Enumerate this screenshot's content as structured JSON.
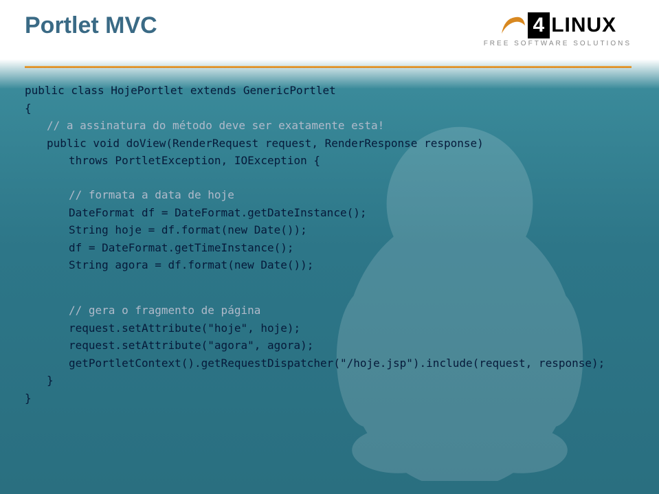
{
  "header": {
    "title": "Portlet MVC",
    "logo_brand": "LINUX",
    "logo_four": "4",
    "logo_tagline": "FREE SOFTWARE SOLUTIONS"
  },
  "code": {
    "l01": "public class HojePortlet extends GenericPortlet",
    "l02": "{",
    "l03": "// a assinatura do método deve ser exatamente esta!",
    "l04": "public void doView(RenderRequest request, RenderResponse response)",
    "l05": "throws PortletException, IOException {",
    "l06": "// formata a data de hoje",
    "l07": "DateFormat df = DateFormat.getDateInstance();",
    "l08": "String hoje = df.format(new Date());",
    "l09": "df = DateFormat.getTimeInstance();",
    "l10": "String agora = df.format(new Date());",
    "l11": "// gera o fragmento de página",
    "l12": "request.setAttribute(\"hoje\", hoje);",
    "l13": "request.setAttribute(\"agora\", agora);",
    "l14": "getPortletContext().getRequestDispatcher(\"/hoje.jsp\").include(request, response);",
    "l15": "}",
    "l16": "}"
  }
}
